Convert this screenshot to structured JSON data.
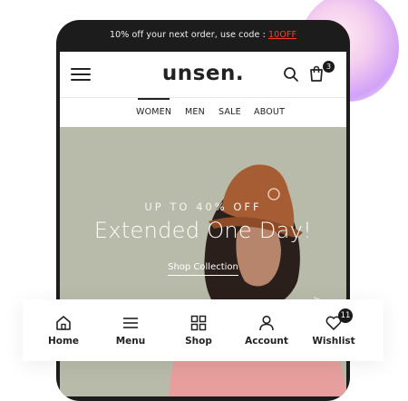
{
  "promo": {
    "text": "10% off your next order, use code : ",
    "code": "10OFF"
  },
  "header": {
    "logo": "unsen.",
    "cart_count": "3"
  },
  "nav": [
    {
      "label": "WOMEN",
      "active": true
    },
    {
      "label": "MEN"
    },
    {
      "label": "SALE"
    },
    {
      "label": "ABOUT"
    }
  ],
  "hero": {
    "subtitle": "UP TO 40% OFF",
    "title": "Extended One Day!",
    "link": "Shop Collection"
  },
  "bottom_nav": [
    {
      "label": "Home",
      "icon": "home-icon"
    },
    {
      "label": "Menu",
      "icon": "menu-icon"
    },
    {
      "label": "Shop",
      "icon": "grid-icon"
    },
    {
      "label": "Account",
      "icon": "user-icon"
    },
    {
      "label": "Wishlist",
      "icon": "heart-icon",
      "badge": "11"
    }
  ],
  "colors": {
    "promo_code": "#ff3b30",
    "hero_bg": "#b8bba9",
    "phone_frame": "#1c1c1c"
  }
}
